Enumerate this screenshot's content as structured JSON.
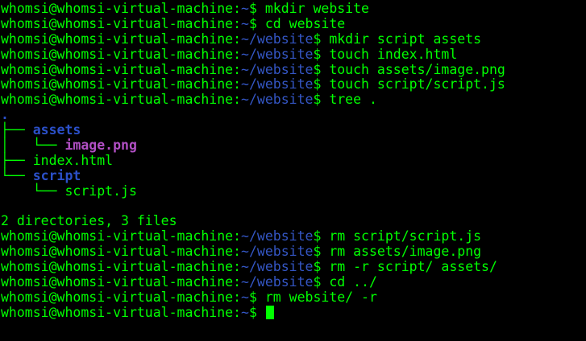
{
  "terminal": {
    "colors": {
      "background": "#000000",
      "text": "#00ff00",
      "path": "#3456c4",
      "directory": "#2b50c9",
      "image_file": "#b14fc4",
      "cursor": "#00ff00"
    },
    "lines": [
      {
        "kind": "prompt",
        "user": "whomsi@whomsi-virtual-machine",
        "sep": ":",
        "path": "~",
        "dollar": "$ ",
        "command": "mkdir website"
      },
      {
        "kind": "prompt",
        "user": "whomsi@whomsi-virtual-machine",
        "sep": ":",
        "path": "~",
        "dollar": "$ ",
        "command": "cd website"
      },
      {
        "kind": "prompt",
        "user": "whomsi@whomsi-virtual-machine",
        "sep": ":",
        "path": "~/website",
        "dollar": "$ ",
        "command": "mkdir script assets"
      },
      {
        "kind": "prompt",
        "user": "whomsi@whomsi-virtual-machine",
        "sep": ":",
        "path": "~/website",
        "dollar": "$ ",
        "command": "touch index.html"
      },
      {
        "kind": "prompt",
        "user": "whomsi@whomsi-virtual-machine",
        "sep": ":",
        "path": "~/website",
        "dollar": "$ ",
        "command": "touch assets/image.png"
      },
      {
        "kind": "prompt",
        "user": "whomsi@whomsi-virtual-machine",
        "sep": ":",
        "path": "~/website",
        "dollar": "$ ",
        "command": "touch script/script.js"
      },
      {
        "kind": "prompt",
        "user": "whomsi@whomsi-virtual-machine",
        "sep": ":",
        "path": "~/website",
        "dollar": "$ ",
        "command": "tree ."
      },
      {
        "kind": "tree",
        "prefix": "",
        "name": ".",
        "type": "dir"
      },
      {
        "kind": "tree",
        "prefix": "├── ",
        "name": "assets",
        "type": "dir"
      },
      {
        "kind": "tree",
        "prefix": "│   └── ",
        "name": "image.png",
        "type": "image"
      },
      {
        "kind": "tree",
        "prefix": "├── ",
        "name": "index.html",
        "type": "file"
      },
      {
        "kind": "tree",
        "prefix": "└── ",
        "name": "script",
        "type": "dir"
      },
      {
        "kind": "tree",
        "prefix": "    └── ",
        "name": "script.js",
        "type": "file"
      },
      {
        "kind": "text",
        "text": ""
      },
      {
        "kind": "text",
        "text": "2 directories, 3 files"
      },
      {
        "kind": "prompt",
        "user": "whomsi@whomsi-virtual-machine",
        "sep": ":",
        "path": "~/website",
        "dollar": "$ ",
        "command": "rm script/script.js"
      },
      {
        "kind": "prompt",
        "user": "whomsi@whomsi-virtual-machine",
        "sep": ":",
        "path": "~/website",
        "dollar": "$ ",
        "command": "rm assets/image.png"
      },
      {
        "kind": "prompt",
        "user": "whomsi@whomsi-virtual-machine",
        "sep": ":",
        "path": "~/website",
        "dollar": "$ ",
        "command": "rm -r script/ assets/"
      },
      {
        "kind": "prompt",
        "user": "whomsi@whomsi-virtual-machine",
        "sep": ":",
        "path": "~/website",
        "dollar": "$ ",
        "command": "cd ../"
      },
      {
        "kind": "prompt",
        "user": "whomsi@whomsi-virtual-machine",
        "sep": ":",
        "path": "~",
        "dollar": "$ ",
        "command": "rm website/ -r"
      },
      {
        "kind": "prompt",
        "user": "whomsi@whomsi-virtual-machine",
        "sep": ":",
        "path": "~",
        "dollar": "$ ",
        "command": "",
        "cursor": true
      }
    ]
  }
}
